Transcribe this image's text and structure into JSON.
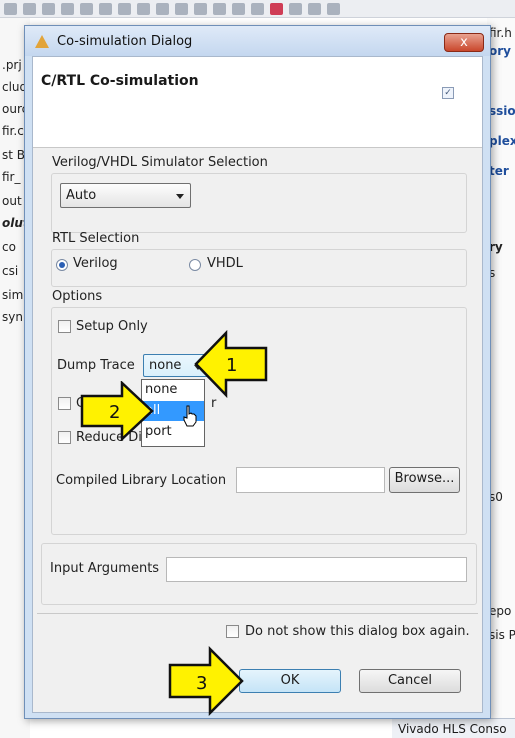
{
  "ide": {
    "left_fragments": [
      ".prj",
      "clud",
      "ourc",
      "fir.c",
      "st B",
      "fir_",
      "out",
      "oluti",
      "co",
      "csi",
      "sim",
      "syn"
    ],
    "right_fragments": [
      "fir.h",
      "ory",
      "ssio",
      "plex",
      "ter",
      "ry",
      "s",
      "s0",
      "epo",
      "sis P"
    ],
    "bottom_tab": "Vivado HLS Conso"
  },
  "dialog": {
    "title": "Co-simulation Dialog",
    "close_symbol": "x",
    "header_title": "C/RTL Co-simulation",
    "header_checkbox_mark": "✓",
    "simulator": {
      "label": "Verilog/VHDL Simulator Selection",
      "selected": "Auto"
    },
    "rtl": {
      "label": "RTL Selection",
      "options": [
        {
          "label": "Verilog",
          "selected": true
        },
        {
          "label": "VHDL",
          "selected": false
        }
      ]
    },
    "options": {
      "label": "Options",
      "setup_only": "Setup Only",
      "dump_trace_label": "Dump Trace",
      "dump_trace_value": "none",
      "dump_trace_choices": [
        "none",
        "all",
        "port"
      ],
      "hidden_option_partial": "O",
      "hidden_option_tail": "r",
      "reduce_diskspace": "Reduce Diskspace",
      "compiled_library_label": "Compiled Library Location",
      "compiled_library_value": "",
      "browse": "Browse..."
    },
    "input_arguments_label": "Input Arguments",
    "input_arguments_value": "",
    "dont_show": "Do not show this dialog box again.",
    "ok": "OK",
    "cancel": "Cancel"
  },
  "callouts": [
    "1",
    "2",
    "3"
  ],
  "colors": {
    "callout_fill": "#fff200",
    "selection": "#3399ff",
    "dialog_frame": "#cfe0f3"
  }
}
